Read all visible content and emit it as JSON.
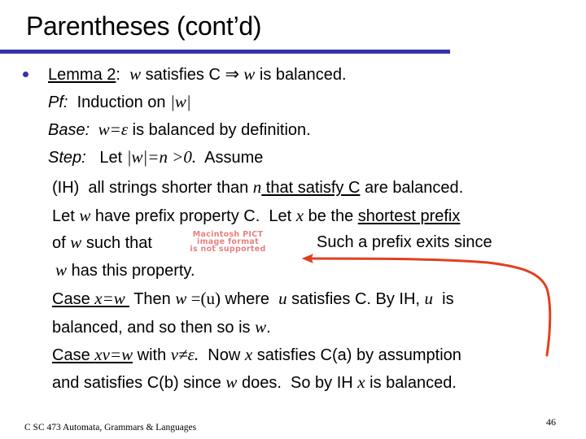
{
  "slide": {
    "title": "Parentheses (cont’d)",
    "accent_color": "#3333aa",
    "arrow_color": "#e04020",
    "lines": {
      "lemma": {
        "label": "Lemma 2",
        "colon": ":",
        "w1": "w",
        "t1": " satisfies C ",
        "implies": "⇒",
        "w2": " w",
        "t2": " is balanced."
      },
      "pf": {
        "label": "Pf:",
        "t1": "  Induction on ",
        "abs": "|w|"
      },
      "base": {
        "label": "Base:",
        "math": "  w=ε",
        "t1": " is balanced by definition."
      },
      "step": {
        "label": "Step:",
        "t1": "   Let ",
        "math": "|w|=n >0.",
        "t2": "  Assume"
      },
      "ih": {
        "t1": "(IH)  all strings shorter than ",
        "n": "n",
        "u1": " that satisfy C",
        "t2": " are balanced."
      },
      "let": {
        "t1": "Let ",
        "w": "w",
        "t2": " have prefix property C.  Let ",
        "x": "x",
        "t3": " be the ",
        "u1": "shortest prefix"
      },
      "of": {
        "t1": "of ",
        "w": "w",
        "t2": " such that",
        "t3": "Such a prefix exits since"
      },
      "has": {
        "w": "w",
        "t1": " has this property."
      },
      "case1": {
        "u_case": "Case ",
        "u_math": "x=w ",
        "t1": " Then ",
        "w": "w",
        "eq": " =(u)",
        "t2": " where  ",
        "u": "u",
        "t3": " satisfies C. By IH, ",
        "u2": "u",
        "t4": "  is"
      },
      "case1b": {
        "t1": "balanced, and so then so is ",
        "w": "w",
        "t2": "."
      },
      "case2": {
        "u_case": "Case ",
        "u_math": "xv=w",
        "t1": " with ",
        "math": "v≠ε.",
        "t2": "  Now ",
        "x": "x",
        "t3": " satisfies C(a) by assumption"
      },
      "case2b": {
        "t1": "and satisfies C(b) since ",
        "w": "w",
        "t2": " does.  So by IH ",
        "x": "x",
        "t3": " is balanced."
      }
    },
    "placeholder_image": {
      "line1": "Macintosh PICT",
      "line2": "image format",
      "line3": "is not supported"
    },
    "footer": "C SC 473 Automata, Grammars & Languages",
    "page_number": "46"
  }
}
